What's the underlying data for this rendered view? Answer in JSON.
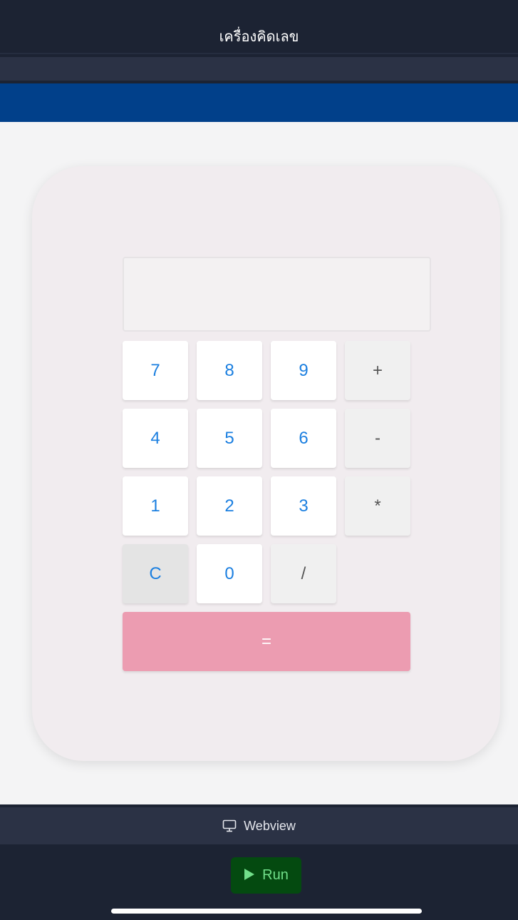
{
  "header": {
    "title": "เครื่องคิดเลข"
  },
  "calculator": {
    "display_value": "",
    "keys": {
      "k7": "7",
      "k8": "8",
      "k9": "9",
      "plus": "+",
      "k4": "4",
      "k5": "5",
      "k6": "6",
      "minus": "-",
      "k1": "1",
      "k2": "2",
      "k3": "3",
      "multiply": "*",
      "clear": "C",
      "k0": "0",
      "divide": "/",
      "equals": "="
    }
  },
  "footer": {
    "webview_label": "Webview",
    "webview_icon": "monitor-icon",
    "run_label": "Run",
    "run_icon": "play-icon"
  },
  "colors": {
    "accent_blue": "#1b7fe0",
    "equals_pink": "#ec9cb1",
    "run_green": "#71e08a",
    "header_blue": "#01408a"
  }
}
